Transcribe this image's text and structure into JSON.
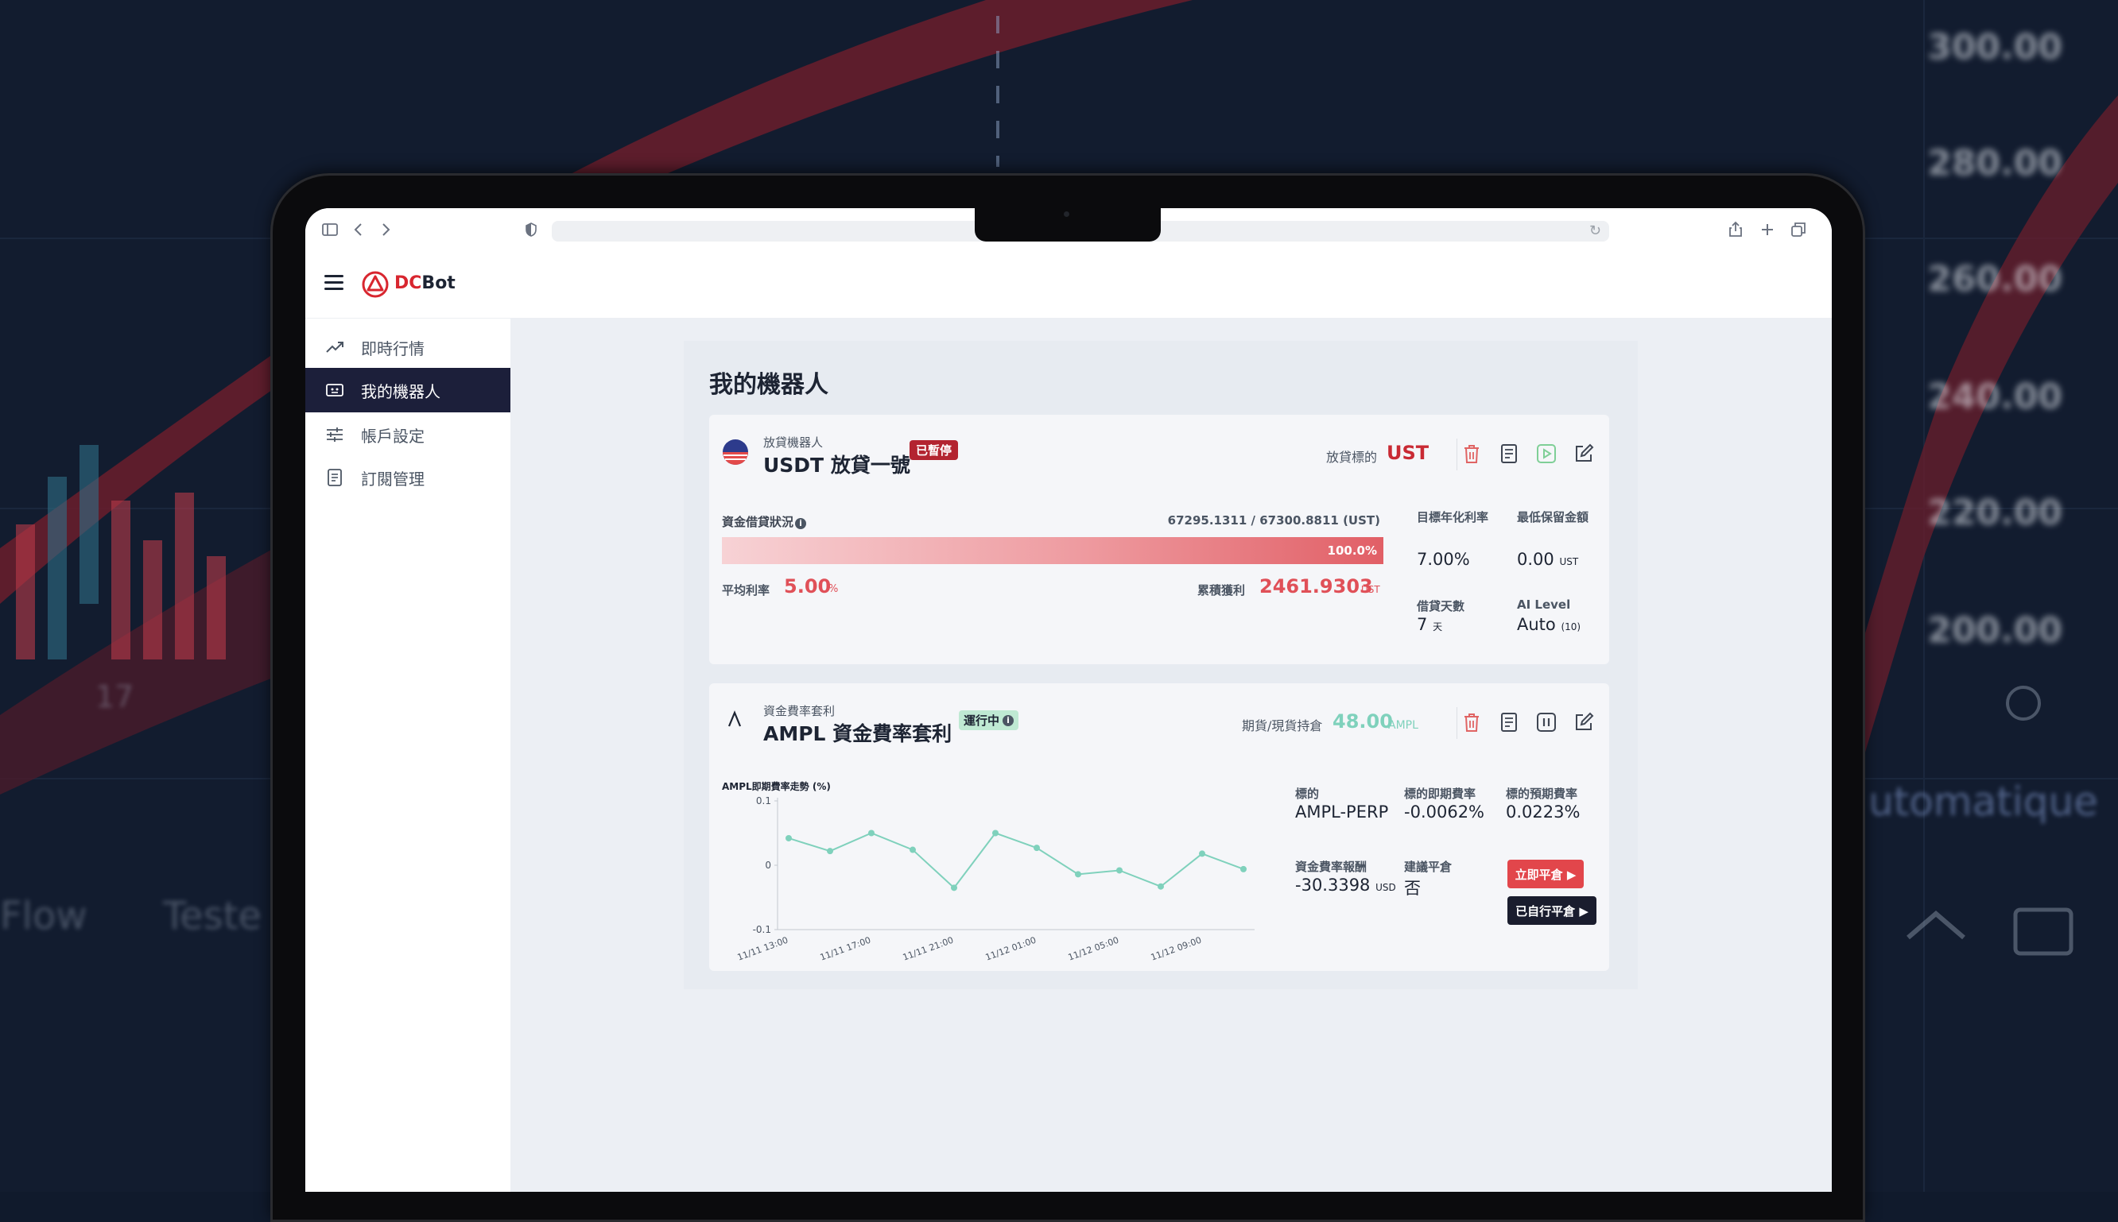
{
  "background": {
    "axis_labels": [
      "300.00",
      "280.00",
      "260.00",
      "240.00",
      "220.00",
      "200.00"
    ],
    "word_right": "utomatique",
    "word_left1": "Flow",
    "word_left2": "Teste",
    "number_left": "17"
  },
  "app": {
    "brand": "DCBot",
    "brand_prefix": "DC",
    "brand_suffix": "Bot",
    "accent": "#d8262f"
  },
  "sidebar": {
    "items": [
      {
        "label": "即時行情",
        "icon": "trending-up-icon",
        "active": false
      },
      {
        "label": "我的機器人",
        "icon": "robot-screen-icon",
        "active": true
      },
      {
        "label": "帳戶設定",
        "icon": "sliders-icon",
        "active": false
      },
      {
        "label": "訂閱管理",
        "icon": "document-icon",
        "active": false
      }
    ]
  },
  "main": {
    "title": "我的機器人",
    "bots": [
      {
        "subtitle": "放貸機器人",
        "name": "USDT 放貸一號",
        "status": "已暫停",
        "target_label": "放貸標的",
        "target_value": "UST",
        "funds_label": "資金借貸狀況",
        "funds_value": "67295.1311 / 67300.8811 (UST)",
        "progress_percent": 100.0,
        "progress_text": "100.0%",
        "avg_rate_label": "平均利率",
        "avg_rate_value": "5.00",
        "avg_rate_unit": "%",
        "cum_profit_label": "累積獲利",
        "cum_profit_value": "2461.9303",
        "cum_profit_unit": "UST",
        "stats": [
          {
            "label": "目標年化利率",
            "value": "7.00%",
            "unit": ""
          },
          {
            "label": "最低保留金額",
            "value": "0.00",
            "unit": "UST"
          },
          {
            "label": "借貸天數",
            "value": "7",
            "unit": "天"
          },
          {
            "label": "AI Level",
            "value": "Auto",
            "unit": "(10)"
          }
        ]
      },
      {
        "subtitle": "資金費率套利",
        "name": "AMPL 資金費率套利",
        "status": "運行中",
        "position_label": "期貨/現貨持倉",
        "position_value": "48.00",
        "position_unit": "AMPL",
        "stats": [
          {
            "label": "標的",
            "value": "AMPL-PERP",
            "unit": ""
          },
          {
            "label": "標的即期費率",
            "value": "-0.0062%",
            "unit": ""
          },
          {
            "label": "標的預期費率",
            "value": "0.0223%",
            "unit": ""
          },
          {
            "label": "資金費率報酬",
            "value": "-30.3398",
            "unit": "USD"
          },
          {
            "label": "建議平倉",
            "value": "否",
            "unit": ""
          }
        ],
        "close_now_button": "立即平倉 ▶",
        "closed_manually_button": "已自行平倉 ▶"
      }
    ]
  },
  "chart_data": {
    "type": "line",
    "title": "AMPL即期費率走勢 (%)",
    "x": [
      "11/11 13:00",
      "11/11 15:00",
      "11/11 17:00",
      "11/11 19:00",
      "11/11 21:00",
      "11/11 23:00",
      "11/12 01:00",
      "11/12 03:00",
      "11/12 05:00",
      "11/12 07:00",
      "11/12 09:00",
      "11/12 11:00"
    ],
    "tick_labels": [
      "11/11 13:00",
      "11/11 17:00",
      "11/11 21:00",
      "11/12 01:00",
      "11/12 05:00",
      "11/12 09:00"
    ],
    "values": [
      0.042,
      0.022,
      0.05,
      0.024,
      -0.035,
      0.05,
      0.027,
      -0.014,
      -0.008,
      -0.033,
      0.018,
      -0.006
    ],
    "y_ticks": [
      "0.1",
      "0",
      "-0.1"
    ],
    "ylim": [
      -0.1,
      0.1
    ],
    "grid": false,
    "color": "#7fd1bc"
  }
}
